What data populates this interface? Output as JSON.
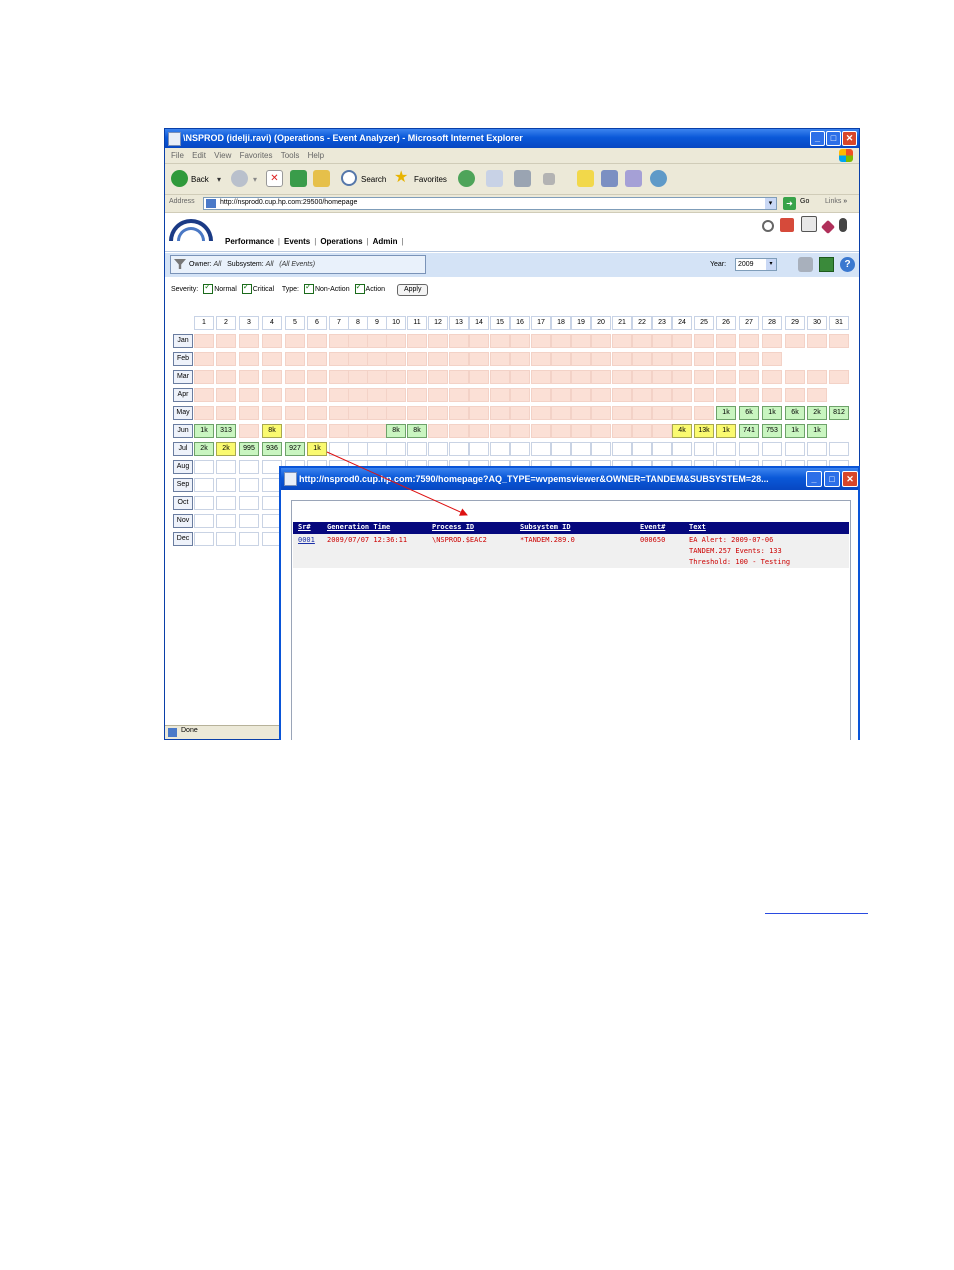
{
  "window": {
    "title": "\\NSPROD (idelji.ravi) (Operations - Event Analyzer) - Microsoft Internet Explorer",
    "menu": [
      "File",
      "Edit",
      "View",
      "Favorites",
      "Tools",
      "Help"
    ],
    "toolbar": {
      "back": "Back",
      "search": "Search",
      "favorites": "Favorites"
    },
    "address": {
      "label": "Address",
      "url": "http://nsprod0.cup.hp.com:29500/homepage",
      "go": "Go",
      "links": "Links"
    },
    "status": "Done"
  },
  "app": {
    "nav": [
      "Performance",
      "Events",
      "Operations",
      "Admin"
    ],
    "filter": {
      "owner_label": "Owner:",
      "owner_value": "All",
      "subsystem_label": "Subsystem:",
      "subsystem_value": "All",
      "events_note": "(All Events)"
    },
    "year_label": "Year:",
    "year_value": "2009",
    "options": {
      "severity_label": "Severity:",
      "normal": "Normal",
      "critical": "Critical",
      "type_label": "Type:",
      "non_action": "Non-Action",
      "action": "Action",
      "apply": "Apply"
    }
  },
  "calendar": {
    "days": [
      "1",
      "2",
      "3",
      "4",
      "5",
      "6",
      "7",
      "8",
      "9",
      "10",
      "11",
      "12",
      "13",
      "14",
      "15",
      "16",
      "17",
      "18",
      "19",
      "20",
      "21",
      "22",
      "23",
      "24",
      "25",
      "26",
      "27",
      "28",
      "29",
      "30",
      "31"
    ],
    "months": [
      {
        "name": "Jan",
        "days": 31,
        "cells": {}
      },
      {
        "name": "Feb",
        "days": 28,
        "cells": {}
      },
      {
        "name": "Mar",
        "days": 31,
        "cells": {}
      },
      {
        "name": "Apr",
        "days": 30,
        "cells": {}
      },
      {
        "name": "May",
        "days": 31,
        "cells": {
          "26": [
            "1k",
            "g"
          ],
          "27": [
            "6k",
            "g"
          ],
          "28": [
            "1k",
            "g"
          ],
          "29": [
            "6k",
            "g"
          ],
          "30": [
            "2k",
            "g"
          ],
          "31": [
            "812",
            "g"
          ]
        }
      },
      {
        "name": "Jun",
        "days": 30,
        "cells": {
          "1": [
            "1k",
            "g"
          ],
          "2": [
            "313",
            "g"
          ],
          "4": [
            "8k",
            "y"
          ],
          "10": [
            "8k",
            "g"
          ],
          "11": [
            "8k",
            "g"
          ],
          "24": [
            "4k",
            "y"
          ],
          "25": [
            "13k",
            "y"
          ],
          "26": [
            "1k",
            "y"
          ],
          "27": [
            "741",
            "g"
          ],
          "28": [
            "753",
            "g"
          ],
          "29": [
            "1k",
            "g"
          ],
          "30": [
            "1k",
            "g"
          ]
        }
      },
      {
        "name": "Jul",
        "days": 31,
        "cells": {
          "1": [
            "2k",
            "g"
          ],
          "2": [
            "2k",
            "y"
          ],
          "3": [
            "995",
            "g"
          ],
          "4": [
            "936",
            "g"
          ],
          "5": [
            "927",
            "g"
          ],
          "6": [
            "1k",
            "y"
          ]
        },
        "past_until": 6
      },
      {
        "name": "Aug",
        "days": 31,
        "cells": {}
      },
      {
        "name": "Sep",
        "days": 30,
        "cells": {}
      },
      {
        "name": "Oct",
        "days": 31,
        "cells": {}
      },
      {
        "name": "Nov",
        "days": 30,
        "cells": {}
      },
      {
        "name": "Dec",
        "days": 31,
        "cells": {}
      }
    ],
    "colors": {
      "past": "#fbe0d6",
      "future": "#ffffff",
      "normal": "#c9f5c0",
      "critical": "#fafa70"
    }
  },
  "popup": {
    "title": "http://nsprod0.cup.hp.com:7590/homepage?AQ_TYPE=wvpemsviewer&OWNER=TANDEM&SUBSYSTEM=28...",
    "columns": {
      "sr": "Sr#",
      "gen_time": "Generation Time",
      "process": "Process ID",
      "subsystem": "Subsystem ID",
      "event": "Event#",
      "text": "Text"
    },
    "row": {
      "sr": "0001",
      "gen_time": "2009/07/07 12:36:11",
      "process": "\\NSPROD.$EAC2",
      "subsystem": "*TANDEM.289.0",
      "event": "000650",
      "text1": "EA Alert: 2009-07-06",
      "text2": "TANDEM.257 Events: 133",
      "text3": "Threshold: 100 - Testing"
    }
  }
}
